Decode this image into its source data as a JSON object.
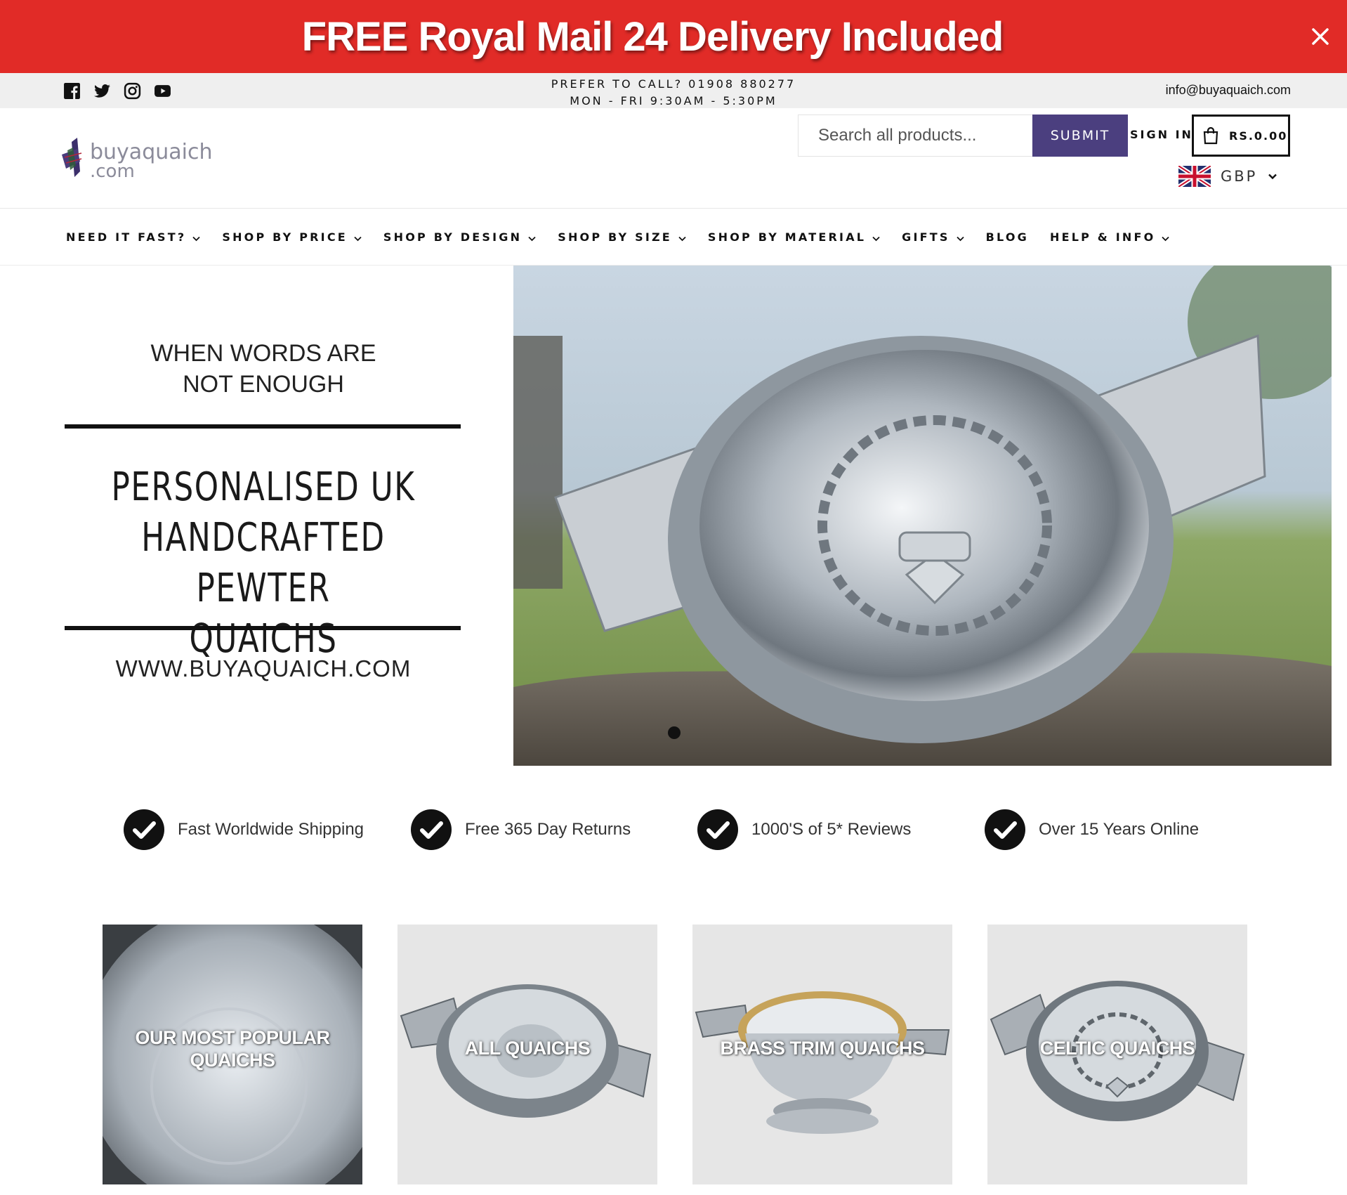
{
  "announcement": {
    "text": "FREE Royal Mail 24 Delivery Included"
  },
  "utility": {
    "call_line1": "PREFER TO CALL? 01908 880277",
    "call_line2": "MON - FRI 9:30AM - 5:30PM",
    "email": "info@buyaquaich.com",
    "social": [
      "facebook-icon",
      "twitter-icon",
      "instagram-icon",
      "youtube-icon"
    ]
  },
  "header": {
    "logo_line1": "buyaquaich",
    "logo_line2": ".com",
    "search_placeholder": "Search all products...",
    "submit_label": "SUBMIT",
    "signin_label": "SIGN IN",
    "cart_total": "RS.0.00",
    "currency": "GBP"
  },
  "nav": {
    "items": [
      {
        "label": "NEED IT FAST?"
      },
      {
        "label": "SHOP BY PRICE"
      },
      {
        "label": "SHOP BY DESIGN"
      },
      {
        "label": "SHOP BY SIZE"
      },
      {
        "label": "SHOP BY MATERIAL"
      },
      {
        "label": "GIFTS"
      },
      {
        "label": "BLOG"
      },
      {
        "label": "HELP & INFO"
      }
    ]
  },
  "hero": {
    "tagline_line1": "WHEN WORDS ARE",
    "tagline_line2": "NOT ENOUGH",
    "heading_line1": "PERSONALISED UK",
    "heading_line2": "HANDCRAFTED PEWTER",
    "heading_line3": "QUAICHS",
    "url": "WWW.BUYAQUAICH.COM"
  },
  "features": [
    {
      "label": "Fast Worldwide Shipping"
    },
    {
      "label": "Free 365 Day Returns"
    },
    {
      "label": "1000'S of 5* Reviews"
    },
    {
      "label": "Over 15 Years Online"
    }
  ],
  "collections": [
    {
      "line1": "OUR MOST POPULAR",
      "line2": "QUAICHS"
    },
    {
      "line1": "ALL QUAICHS"
    },
    {
      "line1": "BRASS TRIM QUAICHS"
    },
    {
      "line1": "CELTIC QUAICHS"
    }
  ],
  "colors": {
    "announcement_bg": "#e12b27",
    "submit_bg": "#4b3f7f",
    "utility_bg": "#efefef"
  }
}
